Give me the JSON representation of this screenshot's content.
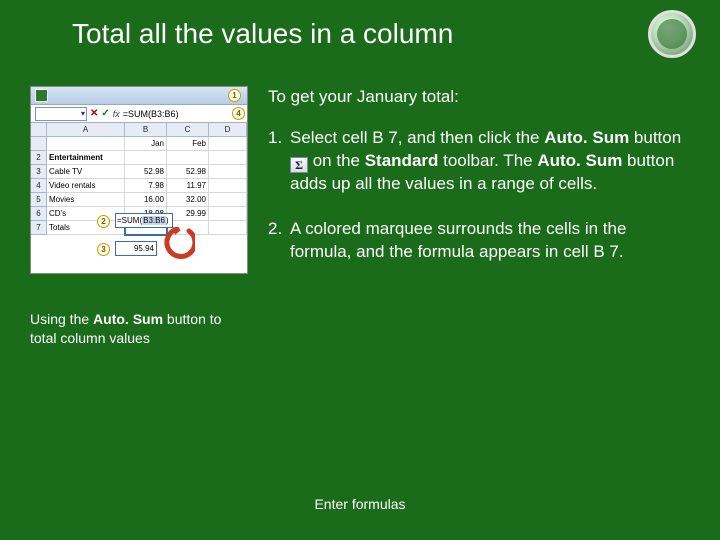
{
  "title": "Total all the values in a column",
  "intro": "To get your January total:",
  "steps": [
    {
      "num": "1.",
      "pre": "Select cell B 7, and then click the ",
      "b1": "Auto. Sum",
      "mid1": " button ",
      "mid2": " on the ",
      "b2": "Standard",
      "mid3": " toolbar. The ",
      "b3": "Auto. Sum",
      "post": " button adds up all the values in a range of cells."
    },
    {
      "num": "2.",
      "text": "A colored marquee surrounds the cells in the formula, and the formula appears in cell B 7."
    }
  ],
  "caption": {
    "pre": "Using the ",
    "bold": "Auto. Sum",
    "post": " button to total column values"
  },
  "footer": "Enter formulas",
  "sigma": "Σ",
  "screenshot": {
    "callouts": {
      "c1": "1",
      "c2": "2",
      "c3": "3",
      "c4": "4"
    },
    "formula": "=SUM(B3:B6)",
    "cols": [
      "A",
      "B",
      "C",
      "D"
    ],
    "colJan": "Jan",
    "colFeb": "Feb",
    "rows": [
      {
        "n": "2",
        "a": "Entertainment",
        "b": "",
        "c": ""
      },
      {
        "n": "3",
        "a": "Cable TV",
        "b": "52.98",
        "c": "52.98"
      },
      {
        "n": "4",
        "a": "Video rentals",
        "b": "7.98",
        "c": "11.97"
      },
      {
        "n": "5",
        "a": "Movies",
        "b": "16.00",
        "c": "32.00"
      },
      {
        "n": "6",
        "a": "CD's",
        "b": "18.98",
        "c": "29.99"
      },
      {
        "n": "7",
        "a": "Totals",
        "b": "",
        "c": ""
      }
    ],
    "sumHint": "=SUM(",
    "sumHintHL": "B3:B6",
    "sumHintEnd": ")",
    "result": "95.94"
  }
}
